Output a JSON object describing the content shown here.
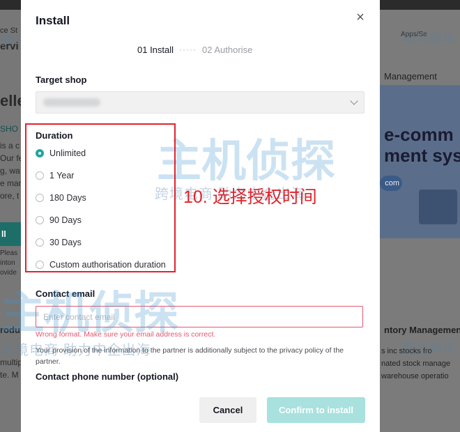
{
  "background": {
    "left_fragments": [
      "ce St",
      "ervi",
      "elle",
      "SHO",
      "is a c",
      "Our fe",
      "g, wa",
      "e man",
      "ore, t",
      "ll",
      "Pleas",
      "inton",
      "ovide",
      "rodu",
      "multip",
      "te. M"
    ],
    "right_fragments": [
      "Apps/Se",
      "Management",
      "e-comm",
      "ment sys",
      "com",
      "ntory Managemen",
      "s inc stocks fro",
      "nated stock manage",
      "warehouse operatio"
    ]
  },
  "watermark": {
    "main": "主机侦探",
    "sub": "跨境电商 助力中企出海",
    "sub_right": "服务跨境"
  },
  "modal": {
    "title": "Install",
    "close_icon": "×",
    "steps": {
      "step1": "01 Install",
      "dots": "·····",
      "step2": "02 Authorise"
    },
    "target_shop": {
      "label": "Target shop"
    },
    "duration": {
      "label": "Duration",
      "options": [
        {
          "label": "Unlimited",
          "selected": true
        },
        {
          "label": "1 Year",
          "selected": false
        },
        {
          "label": "180 Days",
          "selected": false
        },
        {
          "label": "90 Days",
          "selected": false
        },
        {
          "label": "30 Days",
          "selected": false
        },
        {
          "label": "Custom authorisation duration",
          "selected": false
        }
      ]
    },
    "contact_email": {
      "label": "Contact email",
      "placeholder": "Enter contact email",
      "value": "",
      "error": "Wrong format. Make sure your email address is correct.",
      "privacy": "Your provision of the information to the partner is additionally subject to the privacy policy of the partner."
    },
    "contact_phone": {
      "label": "Contact phone number (optional)"
    },
    "buttons": {
      "cancel": "Cancel",
      "confirm": "Confirm to install"
    }
  },
  "annotation": {
    "text": "10. 选择授权时间",
    "color": "#e0232b"
  },
  "colors": {
    "accent": "#1fa6a1",
    "error": "#e5566d",
    "confirm_disabled": "#a8e1dd"
  }
}
